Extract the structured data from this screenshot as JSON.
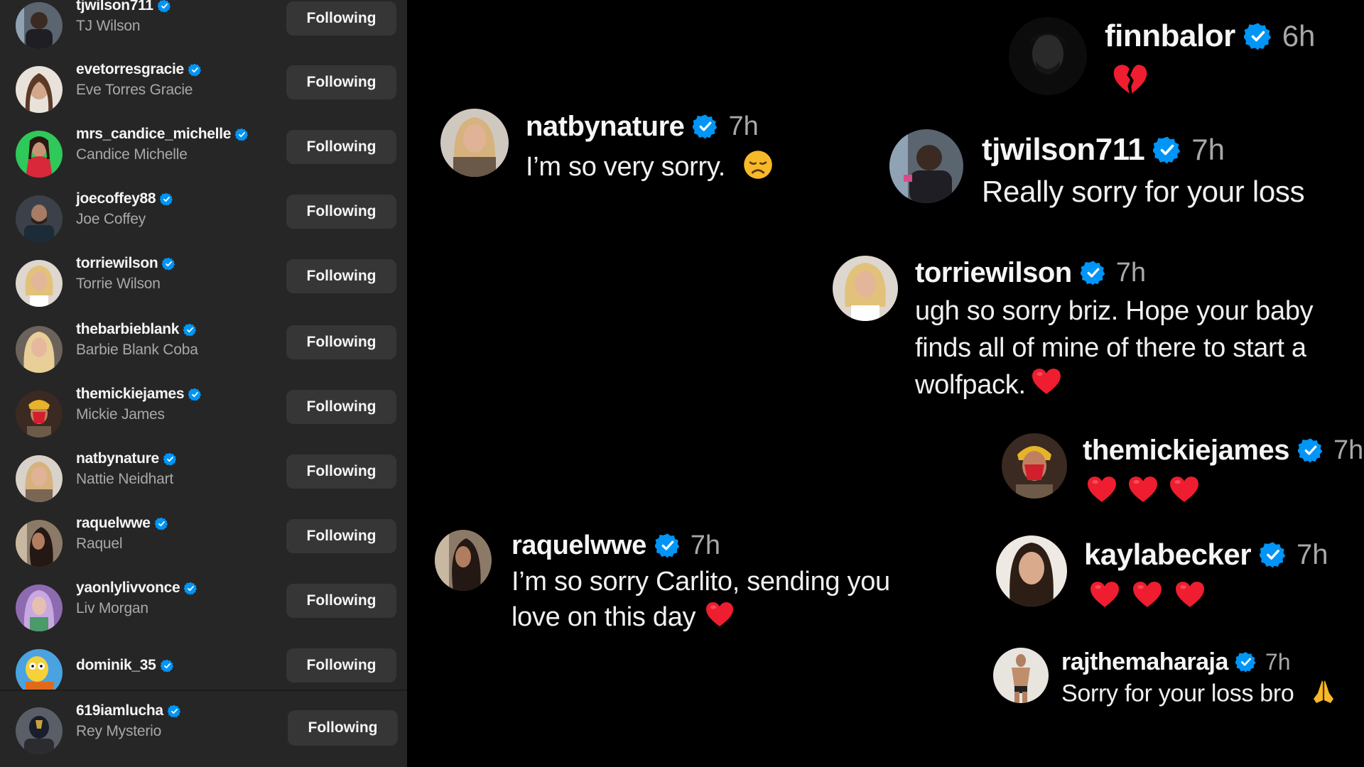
{
  "colors": {
    "panel_bg": "#262626",
    "button_bg": "#363636",
    "verified": "#0095f6",
    "heart_red": "#ee1d2f",
    "secondary_text": "#a8a8a8",
    "background": "#000000"
  },
  "following_list": [
    {
      "username": "tjwilson711",
      "full_name": "TJ Wilson",
      "button": "Following",
      "verified": true
    },
    {
      "username": "evetorresgracie",
      "full_name": "Eve Torres Gracie",
      "button": "Following",
      "verified": true
    },
    {
      "username": "mrs_candice_michelle",
      "full_name": "Candice Michelle",
      "button": "Following",
      "verified": true
    },
    {
      "username": "joecoffey88",
      "full_name": "Joe Coffey",
      "button": "Following",
      "verified": true
    },
    {
      "username": "torriewilson",
      "full_name": "Torrie Wilson",
      "button": "Following",
      "verified": true
    },
    {
      "username": "thebarbieblank",
      "full_name": "Barbie Blank Coba",
      "button": "Following",
      "verified": true
    },
    {
      "username": "themickiejames",
      "full_name": "Mickie James",
      "button": "Following",
      "verified": true
    },
    {
      "username": "natbynature",
      "full_name": "Nattie Neidhart",
      "button": "Following",
      "verified": true
    },
    {
      "username": "raquelwwe",
      "full_name": "Raquel",
      "button": "Following",
      "verified": true
    },
    {
      "username": "yaonlylivvonce",
      "full_name": "Liv Morgan",
      "button": "Following",
      "verified": true
    },
    {
      "username": "dominik_35",
      "full_name": "",
      "button": "Following",
      "verified": true
    },
    {
      "username": "619iamlucha",
      "full_name": "Rey Mysterio",
      "button": "Following",
      "verified": true
    }
  ],
  "comments": [
    {
      "username": "finnbalor",
      "time": "6h",
      "text": "",
      "emoji": "broken-heart",
      "verified": true
    },
    {
      "username": "natbynature",
      "time": "7h",
      "text": "I’m so very sorry.",
      "emoji": "disappointed-face",
      "verified": true
    },
    {
      "username": "tjwilson711",
      "time": "7h",
      "text": "Really sorry for your loss",
      "emoji": "",
      "verified": true
    },
    {
      "username": "torriewilson",
      "time": "7h",
      "text_lines": [
        "ugh so sorry briz. Hope your baby",
        "finds all of mine of there to start a",
        "wolfpack."
      ],
      "emoji": "red-heart",
      "verified": true
    },
    {
      "username": "themickiejames",
      "time": "7h",
      "text": "",
      "emoji": "red-heart-x3",
      "verified": true
    },
    {
      "username": "raquelwwe",
      "time": "7h",
      "text_lines": [
        "I’m so sorry Carlito, sending you",
        "love on this day"
      ],
      "emoji": "red-heart",
      "verified": true
    },
    {
      "username": "kaylabecker",
      "time": "7h",
      "text": "",
      "emoji": "red-heart-x3",
      "verified": true
    },
    {
      "username": "rajthemaharaja",
      "time": "7h",
      "text": "Sorry for your loss bro",
      "emoji": "folded-hands",
      "verified": true
    }
  ]
}
